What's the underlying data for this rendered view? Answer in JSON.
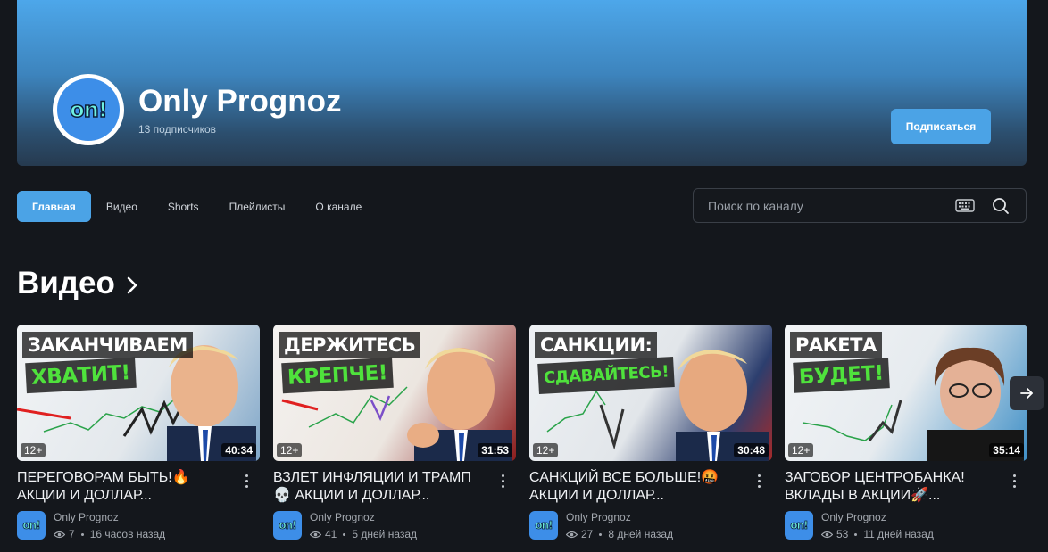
{
  "channel": {
    "name": "Only Prognoz",
    "subscribers": "13 подписчиков",
    "logo_text": "on!",
    "subscribe_label": "Подписаться"
  },
  "nav": {
    "tabs": [
      {
        "label": "Главная",
        "active": true
      },
      {
        "label": "Видео",
        "active": false
      },
      {
        "label": "Shorts",
        "active": false
      },
      {
        "label": "Плейлисты",
        "active": false
      },
      {
        "label": "О канале",
        "active": false
      }
    ]
  },
  "search": {
    "placeholder": "Поиск по каналу",
    "value": ""
  },
  "section": {
    "title": "Видео"
  },
  "videos": [
    {
      "thumb_line1": "ЗАКАНЧИВАЕМ",
      "thumb_line2": "ХВАТИТ!",
      "age": "12+",
      "duration": "40:34",
      "title": "ПЕРЕГОВОРАМ БЫТЬ!🔥 АКЦИИ И ДОЛЛАР...",
      "channel": "Only Prognoz",
      "views": "7",
      "time": "16 часов назад"
    },
    {
      "thumb_line1": "ДЕРЖИТЕСЬ",
      "thumb_line2": "КРЕПЧЕ!",
      "age": "12+",
      "duration": "31:53",
      "title": "ВЗЛЕТ ИНФЛЯЦИИ И ТРАМП 💀 АКЦИИ И ДОЛЛАР...",
      "channel": "Only Prognoz",
      "views": "41",
      "time": "5 дней назад"
    },
    {
      "thumb_line1": "САНКЦИИ:",
      "thumb_line2": "СДАВАЙТЕСЬ!",
      "age": "12+",
      "duration": "30:48",
      "title": "САНКЦИЙ ВСЕ БОЛЬШЕ!🤬 АКЦИИ И ДОЛЛАР...",
      "channel": "Only Prognoz",
      "views": "27",
      "time": "8 дней назад"
    },
    {
      "thumb_line1": "РАКЕТА",
      "thumb_line2": "БУДЕТ!",
      "age": "12+",
      "duration": "35:14",
      "title": "ЗАГОВОР ЦЕНТРОБАНКА! ВКЛАДЫ В АКЦИИ🚀...",
      "channel": "Only Prognoz",
      "views": "53",
      "time": "11 дней назад"
    }
  ],
  "icons": {
    "keyboard": "keyboard-icon",
    "search": "search-icon",
    "chevron": "chevron-right-icon",
    "next": "arrow-right-icon",
    "more": "more-vertical-icon",
    "views": "eye-icon"
  },
  "colors": {
    "accent": "#4ba3e6",
    "background": "#14171c",
    "thumb_green": "#4fe23c"
  }
}
